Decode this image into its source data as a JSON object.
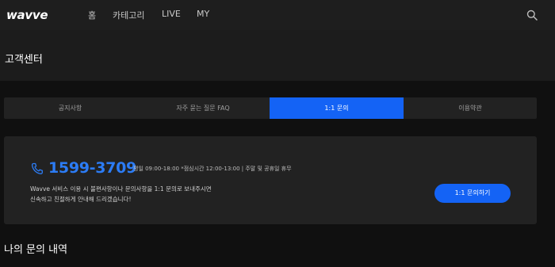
{
  "header": {
    "logo": "wavve",
    "nav": [
      "홈",
      "카테고리",
      "LIVE",
      "MY"
    ]
  },
  "page": {
    "title": "고객센터"
  },
  "tabs": [
    {
      "label": "공지사항",
      "active": false
    },
    {
      "label": "자주 묻는 질문 FAQ",
      "active": false
    },
    {
      "label": "1:1 문의",
      "active": true
    },
    {
      "label": "이용약관",
      "active": false
    }
  ],
  "contact": {
    "phone": "1599-3709",
    "hours": "평일 09:00-18:00 *점심시간 12:00-13:00 | 주말 및 공휴일 휴무",
    "desc_line1": "Wavve 서비스 이용 시 불편사항이나 문의사항을 1:1 문의로 보내주시면",
    "desc_line2": "신속하고 친절하게 안내해 드리겠습니다!",
    "button_label": "1:1 문의하기"
  },
  "section": {
    "my_inquiries_title": "나의 문의 내역"
  },
  "colors": {
    "accent": "#1463f5",
    "phone": "#2c7cf5"
  }
}
